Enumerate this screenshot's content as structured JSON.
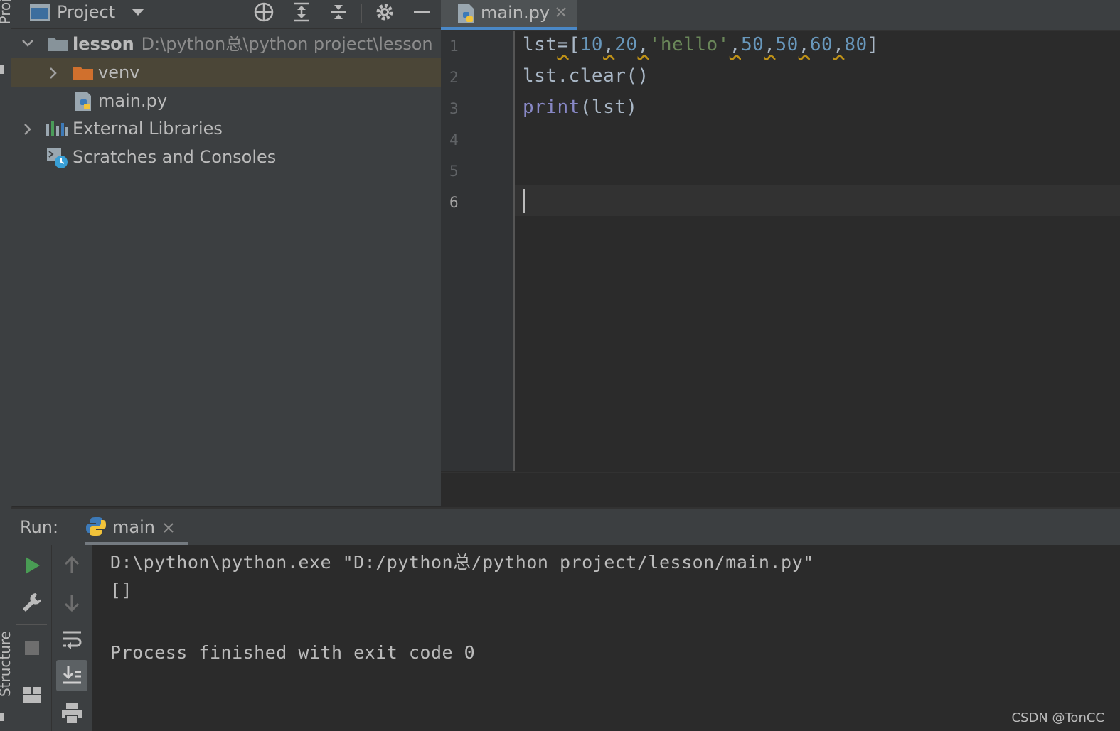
{
  "sidebar": {
    "project_label": "Project",
    "structure_label": "Structure"
  },
  "project_panel": {
    "title": "Project",
    "tree": [
      {
        "label": "lesson",
        "path": "D:\\python总\\python project\\lesson",
        "expanded": true,
        "icon": "folder-icon"
      },
      {
        "label": "venv",
        "expanded": false,
        "icon": "folder-excluded-icon",
        "selected": true
      },
      {
        "label": "main.py",
        "icon": "python-file-icon"
      },
      {
        "label": "External Libraries",
        "expanded": false,
        "icon": "libraries-icon"
      },
      {
        "label": "Scratches and Consoles",
        "icon": "scratches-icon"
      }
    ]
  },
  "editor": {
    "tab_label": "main.py",
    "line_numbers": [
      "1",
      "2",
      "3",
      "4",
      "5",
      "6"
    ],
    "current_line": 6,
    "code": {
      "line1": {
        "var": "lst",
        "eq": "=",
        "open": "[",
        "n1": "10",
        "n2": "20",
        "s1": "'hello'",
        "n3": "50",
        "n4": "50",
        "n5": "60",
        "n6": "80",
        "comma": ",",
        "close": "]"
      },
      "line2": "lst.clear()",
      "line3": {
        "fn": "print",
        "args": "(lst)"
      }
    }
  },
  "run": {
    "label": "Run:",
    "tab_label": "main",
    "output": [
      "D:\\python\\python.exe \"D:/python总/python project/lesson/main.py\"",
      "[]",
      "",
      "Process finished with exit code 0"
    ]
  },
  "watermark": "CSDN @TonCC",
  "colors": {
    "background": "#2b2b2b",
    "panel": "#3c3f41",
    "accent": "#4a88c7",
    "number": "#6897bb",
    "string": "#6a8759",
    "builtin": "#8888c6",
    "run_green": "#499c54"
  }
}
